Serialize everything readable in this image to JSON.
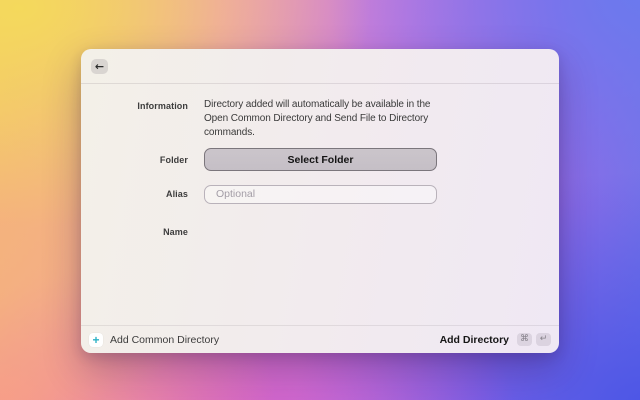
{
  "window": {
    "back_icon": "←"
  },
  "form": {
    "information_label": "Information",
    "information_text": "Directory added will automatically be available in the\nOpen Common Directory and Send File to Directory\ncommands.",
    "folder_label": "Folder",
    "select_folder_button": "Select Folder",
    "alias_label": "Alias",
    "alias_placeholder": "Optional",
    "alias_value": "",
    "name_label": "Name",
    "name_value": ""
  },
  "footer": {
    "plus_icon": "+",
    "add_common_label": "Add Common Directory",
    "add_directory_label": "Add Directory",
    "command_key": "⌘",
    "return_key": "↵"
  },
  "colors": {
    "accent_teal": "#2bb1c5",
    "select_button_fill": "#c8c2c8",
    "select_button_border": "#7b767c",
    "window_left_tint": "#f3f0e8",
    "window_right_tint": "#efe8f4"
  }
}
